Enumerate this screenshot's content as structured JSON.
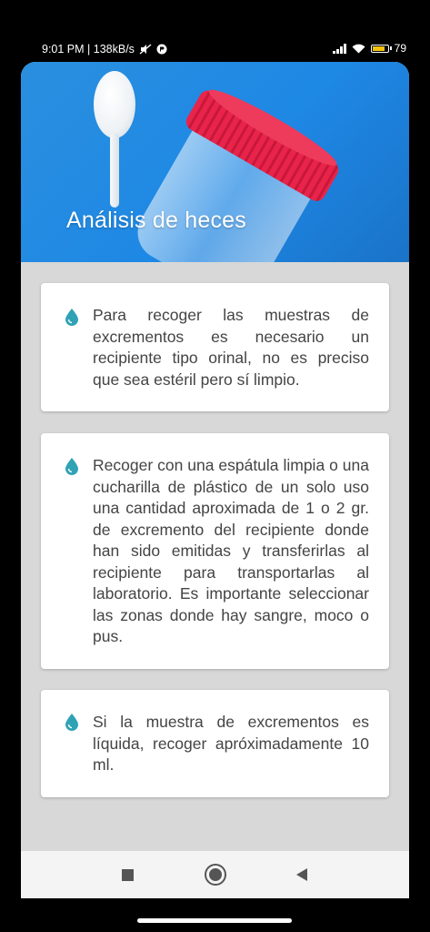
{
  "status_bar": {
    "time_speed": "9:01 PM | 138kB/s",
    "battery": "79"
  },
  "header": {
    "title": "Análisis de heces"
  },
  "cards": [
    {
      "icon": "water-drop-icon",
      "text": "Para recoger las muestras de excrementos es necesario un recipiente tipo orinal, no es preciso que sea estéril pero sí limpio."
    },
    {
      "icon": "water-drop-icon",
      "text": "Recoger con una espátula limpia o una cucharilla de plástico de un solo uso una cantidad aproximada de 1 o 2 gr. de excremento del recipiente donde han sido emitidas y transferirlas al recipiente para transportarlas al laboratorio. Es importante seleccionar las zonas donde hay sangre, moco o pus."
    },
    {
      "icon": "water-drop-icon",
      "text": "Si la muestra de excrementos es líquida, recoger apróximadamente 10 ml."
    }
  ],
  "colors": {
    "header_blue": "#1e88e5",
    "drop_teal": "#2fa3b5",
    "background_gray": "#d8d8d8"
  }
}
